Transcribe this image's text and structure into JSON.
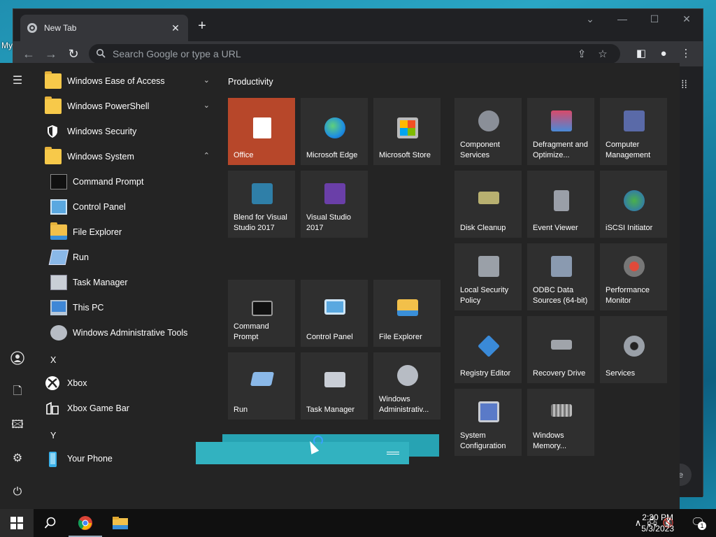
{
  "desktop": {
    "label": "My"
  },
  "browser": {
    "tab_title": "New Tab",
    "tab_close": "✕",
    "new_tab": "+",
    "window_controls": [
      "⌄",
      "—",
      "☐",
      "✕"
    ],
    "back": "←",
    "forward": "→",
    "reload": "↻",
    "omnibox_placeholder": "Search Google or type a URL",
    "toolbar_icons": [
      "share-icon",
      "bookmark-star-icon",
      "side-panel-icon",
      "profile-icon",
      "menu-icon"
    ],
    "customize_label": "e"
  },
  "start_menu": {
    "rail": [
      "hamburger-icon",
      "user-icon",
      "documents-icon",
      "pictures-icon",
      "settings-icon",
      "power-icon"
    ],
    "apps": [
      {
        "label": "Windows Ease of Access",
        "type": "folder",
        "chevron": "⌄"
      },
      {
        "label": "Windows PowerShell",
        "type": "folder",
        "chevron": "⌄"
      },
      {
        "label": "Windows Security",
        "type": "shield"
      },
      {
        "label": "Windows System",
        "type": "folder",
        "chevron": "⌃"
      },
      {
        "label": "Command Prompt",
        "type": "cmd",
        "sub": true
      },
      {
        "label": "Control Panel",
        "type": "cpanel",
        "sub": true
      },
      {
        "label": "File Explorer",
        "type": "explorer",
        "sub": true
      },
      {
        "label": "Run",
        "type": "run",
        "sub": true
      },
      {
        "label": "Task Manager",
        "type": "taskmgr",
        "sub": true
      },
      {
        "label": "This PC",
        "type": "pc",
        "sub": true
      },
      {
        "label": "Windows Administrative Tools",
        "type": "admin",
        "sub": true
      }
    ],
    "letters": [
      "X",
      "Y"
    ],
    "apps_x": [
      {
        "label": "Xbox"
      },
      {
        "label": "Xbox Game Bar"
      }
    ],
    "apps_y": [
      {
        "label": "Your Phone"
      }
    ],
    "group_title": "Productivity",
    "tiles_productivity": [
      "Office",
      "Microsoft Edge",
      "Microsoft Store",
      "Blend for Visual Studio 2017",
      "Visual Studio 2017"
    ],
    "tiles_system": [
      "Command Prompt",
      "Control Panel",
      "File Explorer",
      "Run",
      "Task Manager",
      "Windows Administrativ..."
    ],
    "tiles_admin": [
      "Component Services",
      "Defragment and Optimize...",
      "Computer Management",
      "Disk Cleanup",
      "Event Viewer",
      "iSCSI Initiator",
      "Local Security Policy",
      "ODBC Data Sources (64-bit)",
      "Performance Monitor",
      "Registry Editor",
      "Recovery Drive",
      "Services",
      "System Configuration",
      "Windows Memory..."
    ]
  },
  "taskbar": {
    "clock_time": "2:30 PM",
    "clock_date": "5/3/2023",
    "notification_count": "1"
  },
  "colors": {
    "office_tile": "#b7472a",
    "drag_band": "#27a3b3",
    "taskbar": "#101010"
  }
}
